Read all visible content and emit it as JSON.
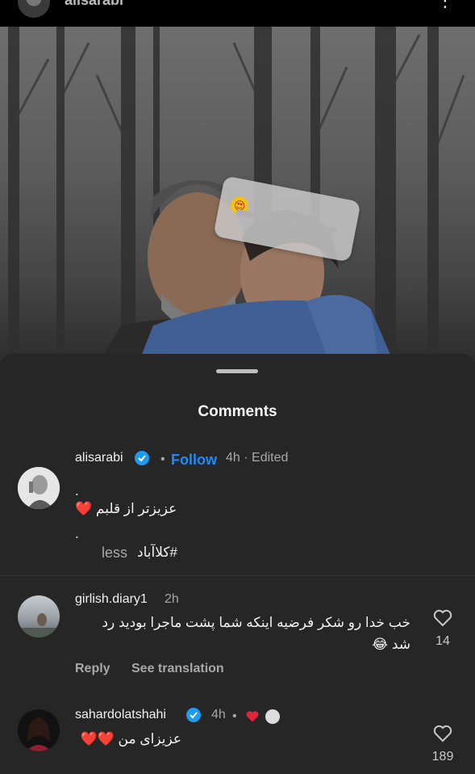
{
  "header": {
    "username": "alisarabi",
    "more_icon": "⋮"
  },
  "sticker": {
    "emoji": "😍"
  },
  "sheet": {
    "title": "Comments"
  },
  "comments": [
    {
      "username": "alisarabi",
      "follow_label": "Follow",
      "meta": "4h · Edited",
      "lines": [
        ".",
        "عزیزتر از قلبم ❤️",
        ".",
        "#کلاآباد"
      ],
      "less_label": "less"
    },
    {
      "username": "girlish.diary1",
      "time": "2h",
      "text_line1": "خب خدا رو شکر فرضیه اینکه شما پشت ماجرا بودید رد",
      "text_line2": "شد 😂",
      "likes": "14",
      "reply_label": "Reply",
      "translate_label": "See translation"
    },
    {
      "username": "sahardolatshahi",
      "time": "4h",
      "text": "عزیزای من ❤️❤️",
      "likes": "189"
    }
  ],
  "colors": {
    "sheet_bg": "#262626",
    "accent": "#1a8cff",
    "heart": "#e0243a",
    "verified": "#1d9bf0"
  }
}
